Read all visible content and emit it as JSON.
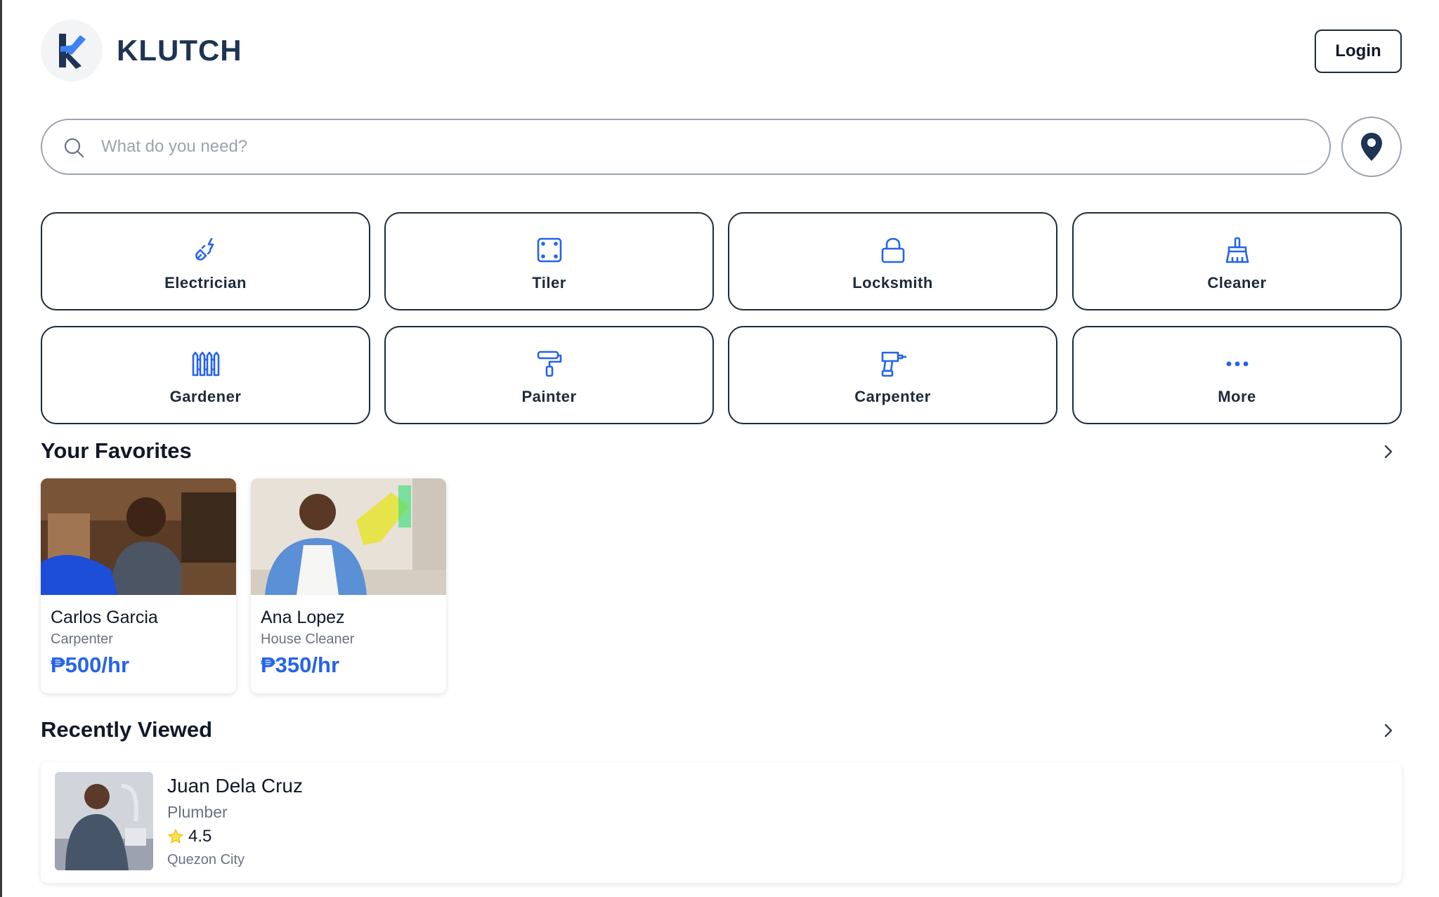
{
  "brand": {
    "name": "KLUTCH",
    "accent": "#2563eb",
    "dark": "#1f3354"
  },
  "header": {
    "login_label": "Login"
  },
  "search": {
    "placeholder": "What do you need?",
    "value": ""
  },
  "categories": [
    {
      "label": "Electrician",
      "icon": "plug-icon"
    },
    {
      "label": "Tiler",
      "icon": "tile-icon"
    },
    {
      "label": "Locksmith",
      "icon": "lock-icon"
    },
    {
      "label": "Cleaner",
      "icon": "broom-icon"
    },
    {
      "label": "Gardener",
      "icon": "fence-icon"
    },
    {
      "label": "Painter",
      "icon": "paint-roller-icon"
    },
    {
      "label": "Carpenter",
      "icon": "drill-icon"
    },
    {
      "label": "More",
      "icon": "more-dots-icon"
    }
  ],
  "favorites": {
    "title": "Your Favorites",
    "items": [
      {
        "name": "Carlos Garcia",
        "role": "Carpenter",
        "rate": "₱500/hr"
      },
      {
        "name": "Ana Lopez",
        "role": "House Cleaner",
        "rate": "₱350/hr"
      }
    ]
  },
  "recent": {
    "title": "Recently Viewed",
    "items": [
      {
        "name": "Juan Dela Cruz",
        "role": "Plumber",
        "rating": "4.5",
        "location": "Quezon City"
      }
    ]
  }
}
